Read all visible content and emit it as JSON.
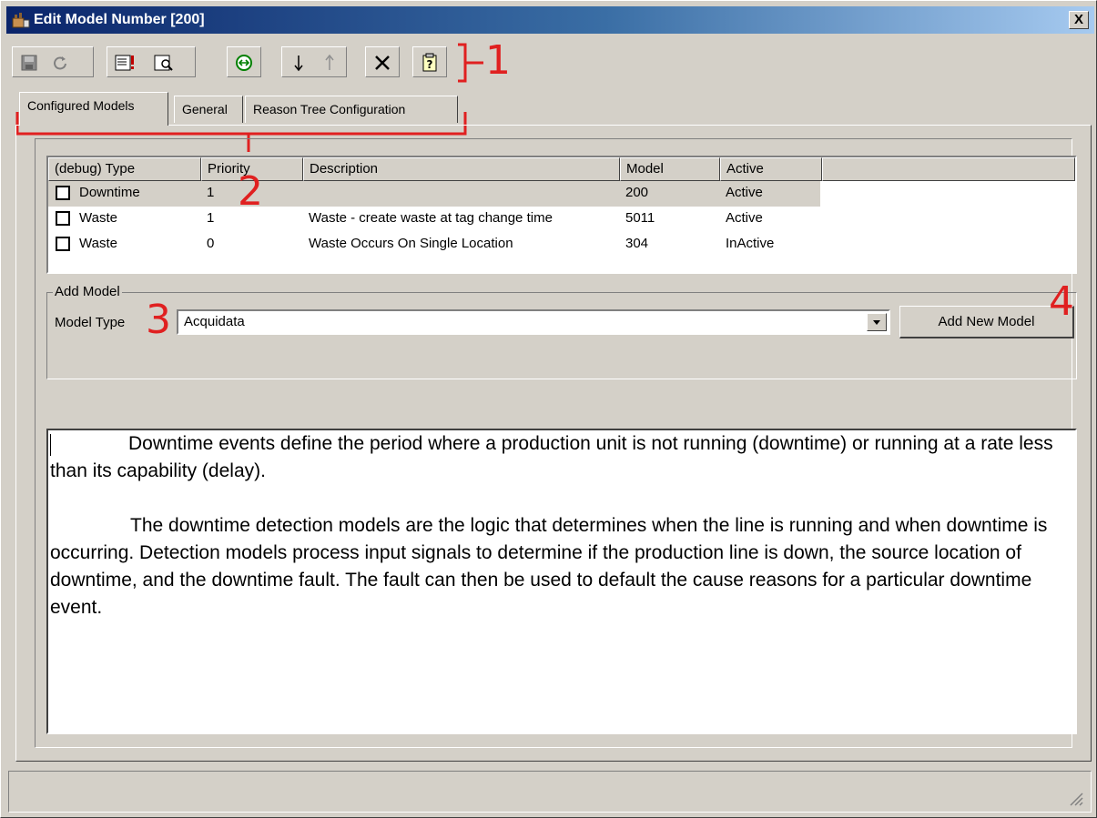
{
  "window": {
    "title": "Edit Model Number [200]",
    "close_label": "X"
  },
  "toolbar": {
    "buttons": [
      {
        "icon": "save-icon"
      },
      {
        "icon": "refresh-icon"
      },
      {
        "icon": "document-warning-icon"
      },
      {
        "icon": "print-preview-icon"
      },
      {
        "icon": "check-circle-icon"
      },
      {
        "icon": "arrow-down-icon"
      },
      {
        "icon": "arrow-up-icon"
      },
      {
        "icon": "delete-icon"
      },
      {
        "icon": "help-icon"
      }
    ]
  },
  "annotations": {
    "one": "1",
    "two": "2",
    "three": "3",
    "four": "4",
    "color": "#e02020"
  },
  "tabs": [
    {
      "label": "Configured Models",
      "active": true
    },
    {
      "label": "General",
      "active": false
    },
    {
      "label": "Reason Tree Configuration",
      "active": false
    }
  ],
  "models_table": {
    "columns": [
      "(debug) Type",
      "Priority",
      "Description",
      "Model",
      "Active"
    ],
    "rows": [
      {
        "type": "Downtime",
        "priority": "1",
        "description": "",
        "model": "200",
        "active": "Active",
        "selected": true
      },
      {
        "type": "Waste",
        "priority": "1",
        "description": "Waste - create waste at tag change time",
        "model": "5011",
        "active": "Active",
        "selected": false
      },
      {
        "type": "Waste",
        "priority": "0",
        "description": "Waste Occurs On Single Location",
        "model": "304",
        "active": "InActive",
        "selected": false
      }
    ]
  },
  "add_model": {
    "legend": "Add Model",
    "model_type_label": "Model Type",
    "model_type_value": "Acquidata",
    "add_button_label": "Add New Model"
  },
  "description": {
    "paragraph1": "Downtime events define the period where a production unit is not running (downtime) or running at a rate less than its capability (delay).",
    "paragraph2": "The downtime detection models are the logic that determines when the line is running and when downtime is occurring.  Detection models process input signals to determine if the production line is down, the source location of downtime, and the downtime fault. The fault can then be used to default the cause reasons for a particular downtime event."
  }
}
